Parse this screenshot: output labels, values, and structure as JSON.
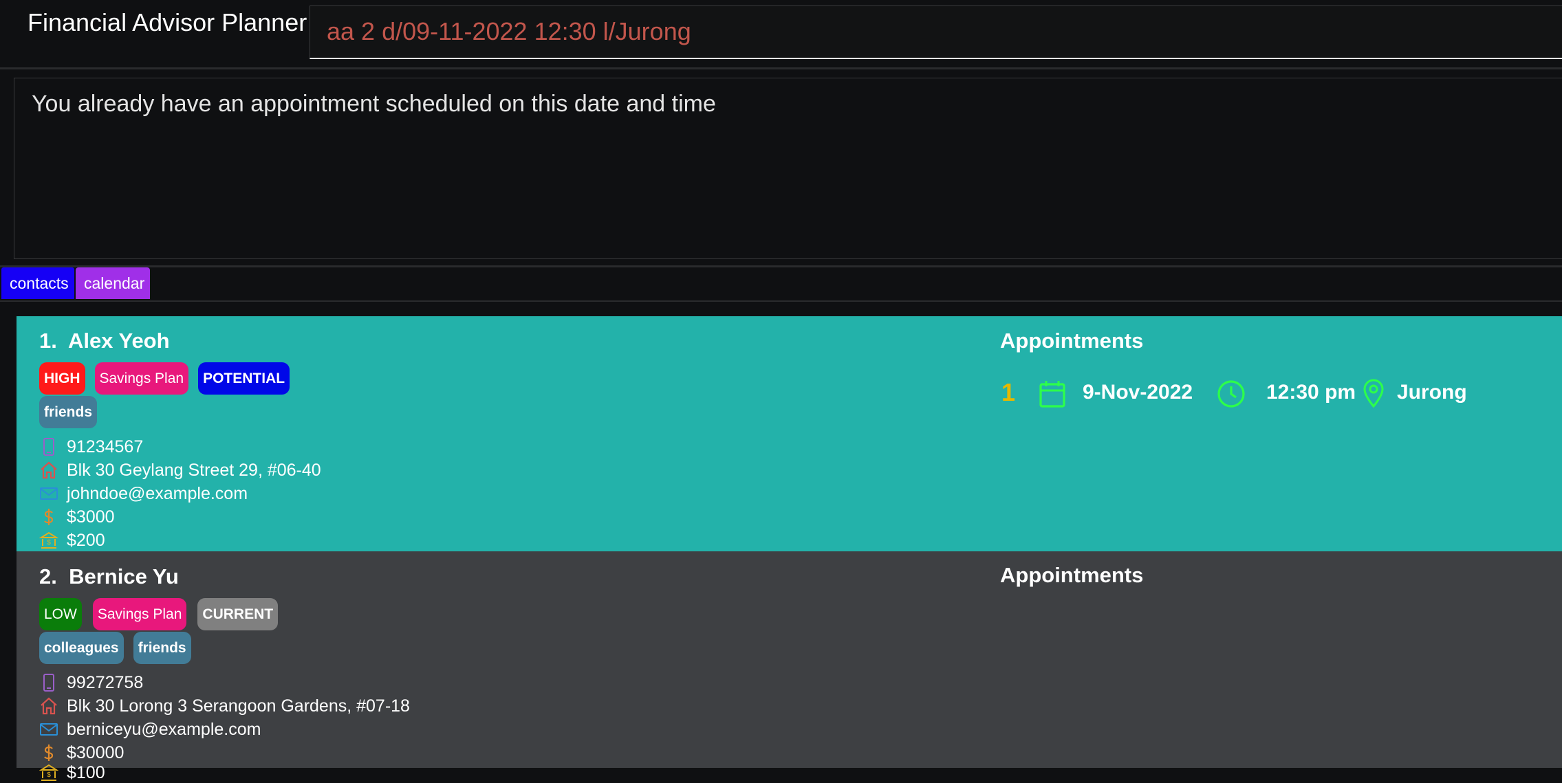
{
  "app": {
    "title": "Financial Advisor Planner",
    "command_value": "aa 2 d/09-11-2022 12:30 l/Jurong",
    "result_message": "You already have an appointment scheduled on this date and time"
  },
  "tabs": [
    {
      "label": "contacts",
      "color": "#1600f5"
    },
    {
      "label": "calendar",
      "color": "#a02fe8"
    }
  ],
  "colors": {
    "selected_card": "#23b2aa",
    "card": "#3e4043",
    "background": "#0f1012",
    "command_text": "#c2564c"
  },
  "contacts": [
    {
      "index": "1.",
      "name": "Alex Yeoh",
      "tags": [
        "HIGH",
        "Savings Plan",
        "POTENTIAL"
      ],
      "tags_row2": [
        "friends"
      ],
      "phone": "91234567",
      "address": "Blk 30 Geylang Street 29, #06-40",
      "email": "johndoe@example.com",
      "income": "$3000",
      "monthly": "$200",
      "appointments_title": "Appointments",
      "appointments": [
        {
          "index": "1",
          "date": "9-Nov-2022",
          "time": "12:30 pm",
          "location": "Jurong"
        }
      ]
    },
    {
      "index": "2.",
      "name": "Bernice Yu",
      "tags": [
        "LOW",
        "Savings Plan",
        "CURRENT"
      ],
      "tags_row2": [
        "colleagues",
        "friends"
      ],
      "phone": "99272758",
      "address": "Blk 30 Lorong 3 Serangoon Gardens, #07-18",
      "email": "berniceyu@example.com",
      "income": "$30000",
      "monthly": "$100",
      "appointments_title": "Appointments",
      "appointments": []
    }
  ]
}
